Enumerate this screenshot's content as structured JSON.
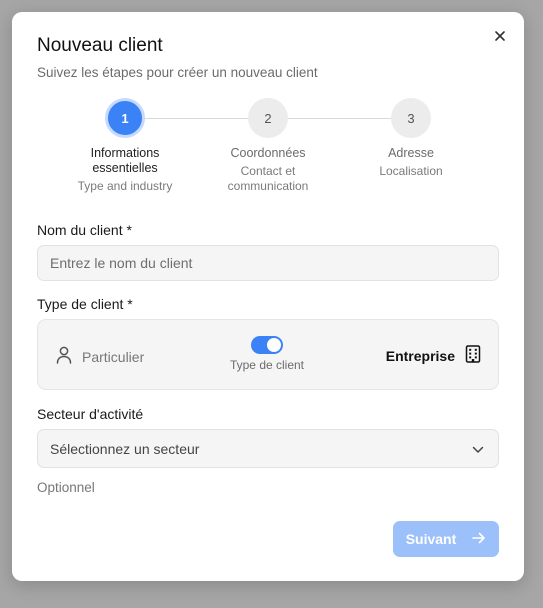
{
  "modal": {
    "title": "Nouveau client",
    "subtitle": "Suivez les étapes pour créer un nouveau client",
    "close_icon": "close-icon"
  },
  "stepper": {
    "steps": [
      {
        "number": "1",
        "title": "Informations essentielles",
        "description": "Type and industry",
        "state": "active"
      },
      {
        "number": "2",
        "title": "Coordonnées",
        "description": "Contact et communication",
        "state": "inactive"
      },
      {
        "number": "3",
        "title": "Adresse",
        "description": "Localisation",
        "state": "inactive"
      }
    ]
  },
  "form": {
    "name": {
      "label": "Nom du client *",
      "placeholder": "Entrez le nom du client",
      "value": ""
    },
    "client_type": {
      "label": "Type de client *",
      "option_left": "Particulier",
      "option_right": "Entreprise",
      "toggle_label": "Type de client",
      "selected": "Entreprise",
      "left_icon": "user-icon",
      "right_icon": "building-icon"
    },
    "sector": {
      "label": "Secteur d'activité",
      "placeholder": "Sélectionnez un secteur",
      "hint": "Optionnel",
      "icon": "chevron-down-icon"
    }
  },
  "footer": {
    "next_label": "Suivant",
    "next_icon": "arrow-right-icon"
  },
  "colors": {
    "accent": "#3b82f6",
    "accent_disabled": "#9cc0fa",
    "backdrop": "#a6a6a6"
  }
}
